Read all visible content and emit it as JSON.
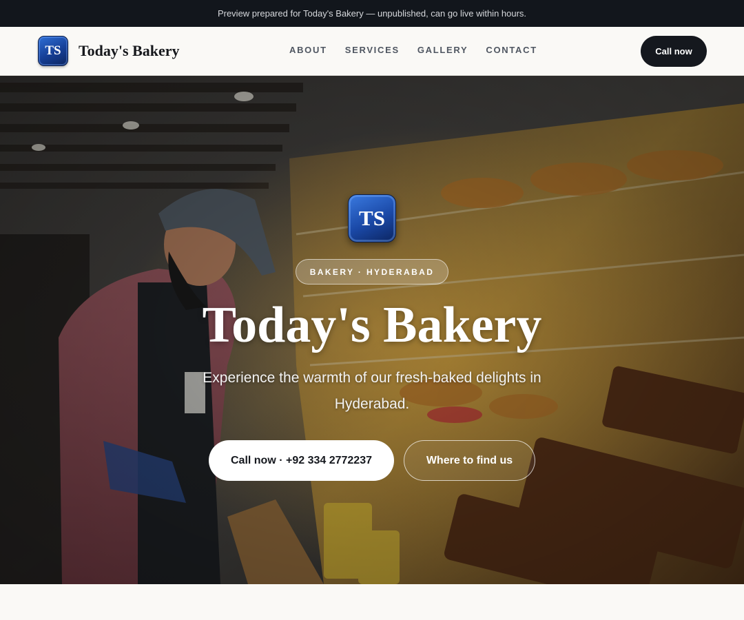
{
  "announcement": "Preview prepared for Today's Bakery — unpublished, can go live within hours.",
  "brand": {
    "initials": "TS",
    "name": "Today's Bakery"
  },
  "nav": {
    "links": [
      "ABOUT",
      "SERVICES",
      "GALLERY",
      "CONTACT"
    ],
    "cta": "Call now"
  },
  "hero": {
    "tag": "BAKERY · HYDERABAD",
    "title": "Today's Bakery",
    "subtitle": "Experience the warmth of our fresh-baked delights in Hyderabad.",
    "primary_button": "Call now · +92 334 2772237",
    "secondary_button": "Where to find us"
  },
  "colors": {
    "topbar": "#12161c",
    "nav_cta": "#15181e",
    "logo_blue": "#1a48a6",
    "page_bg": "#faf9f6"
  }
}
